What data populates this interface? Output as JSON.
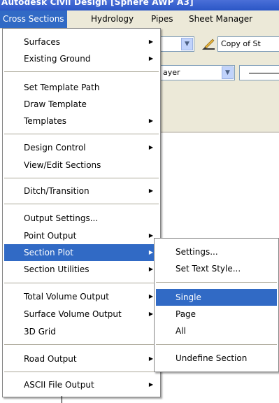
{
  "window": {
    "title": "Autodesk Civil Design [Sphere AWP A3]"
  },
  "menubar": {
    "items": [
      {
        "label": "Cross Sections",
        "active": true
      },
      {
        "label": "Hydrology",
        "active": false
      },
      {
        "label": "Pipes",
        "active": false
      },
      {
        "label": "Sheet Manager",
        "active": false
      }
    ]
  },
  "toolbar": {
    "combo1_text": "",
    "combo2_text": "Copy of St",
    "combo3_text": "ayer",
    "combo4_text": ""
  },
  "menu": {
    "items": [
      {
        "label": "Surfaces",
        "submenu": true
      },
      {
        "label": "Existing Ground",
        "submenu": true
      },
      {
        "label": "Set Template Path",
        "submenu": false
      },
      {
        "label": "Draw Template",
        "submenu": false
      },
      {
        "label": "Templates",
        "submenu": true
      },
      {
        "label": "Design Control",
        "submenu": true
      },
      {
        "label": "View/Edit Sections",
        "submenu": false
      },
      {
        "label": "Ditch/Transition",
        "submenu": true
      },
      {
        "label": "Output Settings...",
        "submenu": false
      },
      {
        "label": "Point Output",
        "submenu": true
      },
      {
        "label": "Section Plot",
        "submenu": true,
        "highlighted": true
      },
      {
        "label": "Section Utilities",
        "submenu": true
      },
      {
        "label": "Total Volume Output",
        "submenu": true
      },
      {
        "label": "Surface Volume Output",
        "submenu": true
      },
      {
        "label": "3D Grid",
        "submenu": false
      },
      {
        "label": "Road Output",
        "submenu": true
      },
      {
        "label": "ASCII File Output",
        "submenu": true
      }
    ]
  },
  "submenu": {
    "items": [
      {
        "label": "Settings..."
      },
      {
        "label": "Set Text Style..."
      },
      {
        "label": "Single",
        "highlighted": true
      },
      {
        "label": "Page"
      },
      {
        "label": "All"
      },
      {
        "label": "Undefine Section"
      }
    ]
  },
  "colors": {
    "highlight": "#316ac5",
    "menubar_bg": "#ece9d8",
    "title_bg": "#2a56c6"
  }
}
